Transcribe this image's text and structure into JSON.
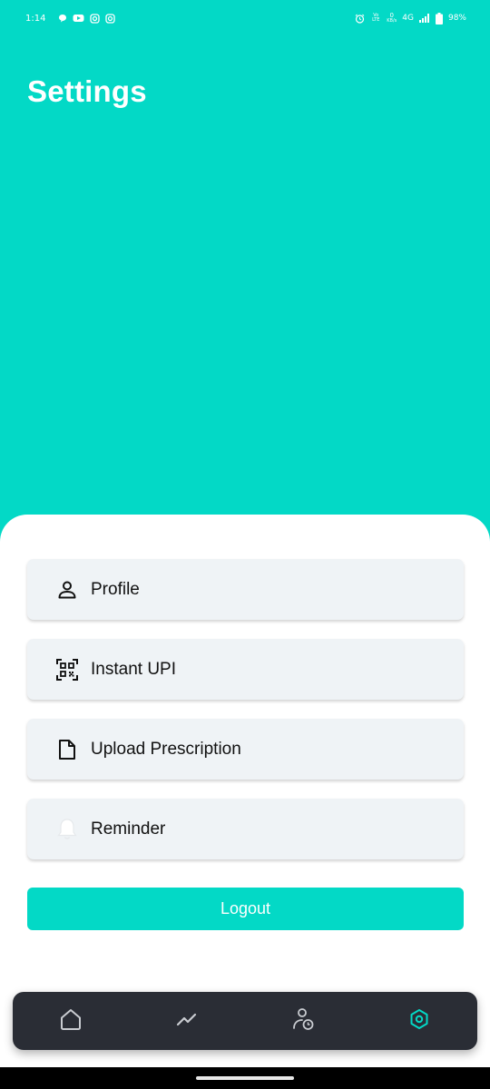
{
  "status_bar": {
    "time": "1:14",
    "network": "4G",
    "battery": "98%",
    "volte": "Vo LTE",
    "speed_value": "0",
    "speed_unit": "KB/s",
    "notification_icons": [
      "chat-icon",
      "youtube-icon",
      "instagram-icon",
      "instagram-icon"
    ]
  },
  "header": {
    "title": "Settings"
  },
  "menu": [
    {
      "label": "Profile",
      "icon": "person-icon"
    },
    {
      "label": "Instant UPI",
      "icon": "qr-code-icon"
    },
    {
      "label": "Upload Prescription",
      "icon": "document-icon"
    },
    {
      "label": "Reminder",
      "icon": "bell-icon"
    }
  ],
  "logout": {
    "label": "Logout"
  },
  "bottom_nav": {
    "items": [
      {
        "icon": "home-icon",
        "active": false
      },
      {
        "icon": "trend-icon",
        "active": false
      },
      {
        "icon": "user-clock-icon",
        "active": false
      },
      {
        "icon": "settings-icon",
        "active": true
      }
    ]
  },
  "colors": {
    "accent": "#03d9c6",
    "sheet_bg": "#ffffff",
    "menu_item_bg": "#eff3f6",
    "nav_bg": "#2a2d35",
    "nav_icon": "#c9ccd1",
    "nav_active": "#03d9c6"
  }
}
